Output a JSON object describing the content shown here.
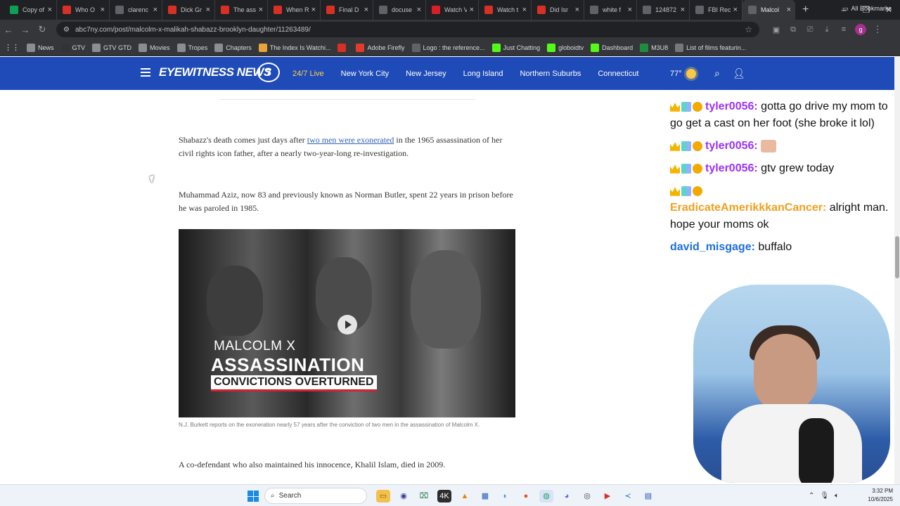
{
  "browser": {
    "tabs": [
      {
        "title": "Copy of",
        "icon": "sheets-icon",
        "color": "#0f9d58"
      },
      {
        "title": "Who O",
        "icon": "youtube-icon",
        "color": "#d93025"
      },
      {
        "title": "clarenc",
        "icon": "globe-icon",
        "color": "#5f6368"
      },
      {
        "title": "Dick Gr",
        "icon": "youtube-icon",
        "color": "#d93025"
      },
      {
        "title": "The ass",
        "icon": "youtube-icon",
        "color": "#d93025"
      },
      {
        "title": "When R",
        "icon": "youtube-icon",
        "color": "#d93025"
      },
      {
        "title": "Final D",
        "icon": "youtube-icon",
        "color": "#d93025"
      },
      {
        "title": "docuse",
        "icon": "globe-icon",
        "color": "#5f6368"
      },
      {
        "title": "Watch V",
        "icon": "netflix-icon",
        "color": "#d81f26"
      },
      {
        "title": "Watch t",
        "icon": "youtube-icon",
        "color": "#d93025"
      },
      {
        "title": "Did Isr",
        "icon": "youtube-icon",
        "color": "#d93025"
      },
      {
        "title": "white f",
        "icon": "globe-icon",
        "color": "#5f6368"
      },
      {
        "title": "124872",
        "icon": "globe-icon",
        "color": "#5f6368"
      },
      {
        "title": "FBI Rec",
        "icon": "globe-icon",
        "color": "#5f6368"
      },
      {
        "title": "Malcol",
        "icon": "abc-icon",
        "color": "#5f6368",
        "active": true
      }
    ],
    "url": "abc7ny.com/post/malcolm-x-malikah-shabazz-brooklyn-daughter/11263489/",
    "profile_initial": "g",
    "bookmarks": [
      {
        "label": "News",
        "icon": "folder-icon"
      },
      {
        "label": "GTV",
        "icon": "github-icon"
      },
      {
        "label": "GTV GTD",
        "icon": "folder-icon"
      },
      {
        "label": "Movies",
        "icon": "folder-icon"
      },
      {
        "label": "Tropes",
        "icon": "folder-icon"
      },
      {
        "label": "Chapters",
        "icon": "folder-icon"
      },
      {
        "label": "The Index Is Watchi...",
        "icon": "bookmark-icon"
      },
      {
        "label": "",
        "icon": "youtube-icon"
      },
      {
        "label": "Adobe Firefly",
        "icon": "adobe-icon"
      },
      {
        "label": "Logo : the reference...",
        "icon": "doc-icon"
      },
      {
        "label": "Just Chatting",
        "icon": "kick-icon"
      },
      {
        "label": "globoidtv",
        "icon": "kick-icon"
      },
      {
        "label": "Dashboard",
        "icon": "kick-icon"
      },
      {
        "label": "M3U8",
        "icon": "globe-icon"
      },
      {
        "label": "List of films featurin...",
        "icon": "wiki-icon"
      }
    ],
    "all_bookmarks": "All Bookmarks"
  },
  "site": {
    "logo_text": "EYEWITNESS NEWS",
    "logo_number": "7",
    "nav": [
      "24/7 Live",
      "New York City",
      "New Jersey",
      "Long Island",
      "Northern Suburbs",
      "Connecticut"
    ],
    "temperature": "77°",
    "brand_color": "#1f4bb8"
  },
  "article": {
    "p1_before": "Shabazz's death comes just days after ",
    "p1_link": "two men were exonerated",
    "p1_after": " in the 1965 assassination of her civil rights icon father, after a nearly two-year-long re-investigation.",
    "p2": "Muhammad Aziz, now 83 and previously known as Norman Butler, spent 22 years in prison before he was paroled in 1985.",
    "video_line1": "MALCOLM X",
    "video_line2": "ASSASSINATION",
    "video_line3": "CONVICTIONS OVERTURNED",
    "caption": "N.J. Burkett reports on the exoneration nearly 57 years after the conviction of two men in the assassination of Malcolm X.",
    "p3": "A co-defendant who also maintained his innocence, Khalil Islam, died in 2009."
  },
  "chat": [
    {
      "user": "tyler0056",
      "color": "purple",
      "text": "gotta go drive my mom to go get a cast on her foot (she broke it lol)",
      "badges": 3
    },
    {
      "user": "tyler0056",
      "color": "purple",
      "text": "",
      "emote": true,
      "badges": 3
    },
    {
      "user": "tyler0056",
      "color": "purple",
      "text": "gtv grew today",
      "badges": 3
    },
    {
      "user": "EradicateAmerikkkanCancer",
      "color": "orange",
      "text": "alright man. hope your moms ok",
      "badges": 3,
      "badges_own_line": true
    },
    {
      "user": "david_misgage",
      "color": "blue",
      "text": "buffalo",
      "badges": 0
    }
  ],
  "taskbar": {
    "search": "Search",
    "time": "3:32 PM",
    "date": "10/6/2025"
  }
}
